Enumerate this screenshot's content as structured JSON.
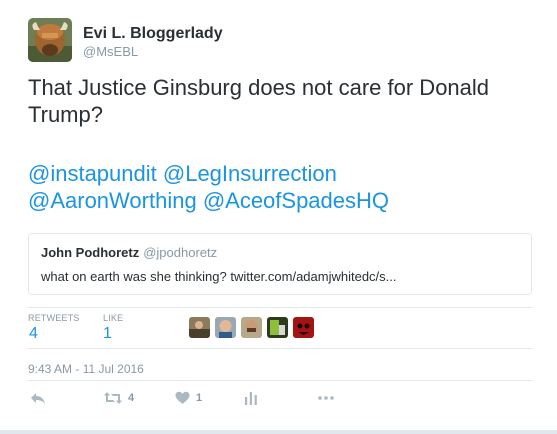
{
  "author": {
    "name": "Evi L. Bloggerlady",
    "handle": "@MsEBL",
    "avatar_icon": "highland-cow-avatar"
  },
  "tweet": {
    "text": "That Justice Ginsburg does not care for Donald Trump?",
    "mentions": [
      "@instapundit",
      "@LegInsurrection",
      "@AaronWorthing",
      "@AceofSpadesHQ"
    ]
  },
  "quoted": {
    "name": "John Podhoretz",
    "handle": "@jpodhoretz",
    "text": "what on earth was she thinking? twitter.com/adamjwhitedc/s..."
  },
  "stats": {
    "retweets_label": "RETWEETS",
    "retweets_value": "4",
    "likes_label": "LIKE",
    "likes_value": "1"
  },
  "timestamp": "9:43 AM - 11 Jul 2016",
  "actions": {
    "reply_icon": "reply-icon",
    "retweet_icon": "retweet-icon",
    "retweet_count": "4",
    "like_icon": "heart-icon",
    "like_count": "1",
    "analytics_icon": "analytics-icon",
    "more_icon": "more-icon"
  },
  "colors": {
    "link": "#1b95e0",
    "muted": "#8899a6",
    "border": "#e1e8ed",
    "text": "#292f33"
  }
}
